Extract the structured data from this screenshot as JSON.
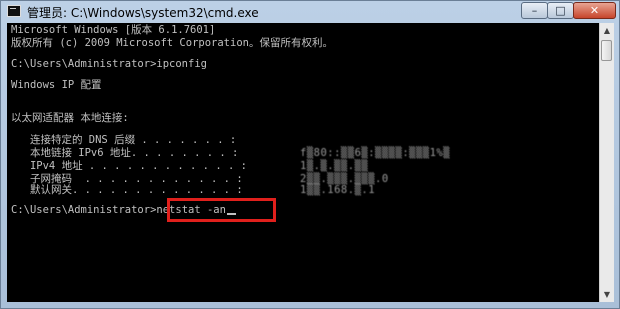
{
  "window": {
    "title": "管理员: C:\\Windows\\system32\\cmd.exe",
    "icon": "console-icon",
    "buttons": {
      "minimize": "–",
      "maximize": "□",
      "close": "✕"
    }
  },
  "console": {
    "lines": [
      "Microsoft Windows [版本 6.1.7601]",
      "版权所有 (c) 2009 Microsoft Corporation。保留所有权利。",
      "",
      "C:\\Users\\Administrator>ipconfig",
      "",
      "Windows IP 配置",
      "",
      "",
      "以太网适配器 本地连接:",
      "",
      "   连接特定的 DNS 后缀 . . . . . . . :",
      "   本地链接 IPv6 地址. . . . . . . . :",
      "   IPv4 地址 . . . . . . . . . . . . :",
      "   子网掩码  . . . . . . . . . . . . :",
      "   默认网关. . . . . . . . . . . . . :",
      ""
    ],
    "blurred_values": [
      "f▒80::▒▒6▒:▒▒▒▒:▒▒▒1%▒",
      "1▒.▒.▒▒.▒▒",
      "2▒▒.▒▒▒.▒▒▒.0",
      "1▒▒.168.▒.1"
    ],
    "prompt": "C:\\Users\\Administrator>",
    "command": "netstat -an"
  },
  "scrollbar": {
    "up": "▲",
    "down": "▼"
  },
  "colors": {
    "highlight_border": "#e0201c",
    "console_bg": "#000000",
    "console_text": "#c0c0c0"
  }
}
